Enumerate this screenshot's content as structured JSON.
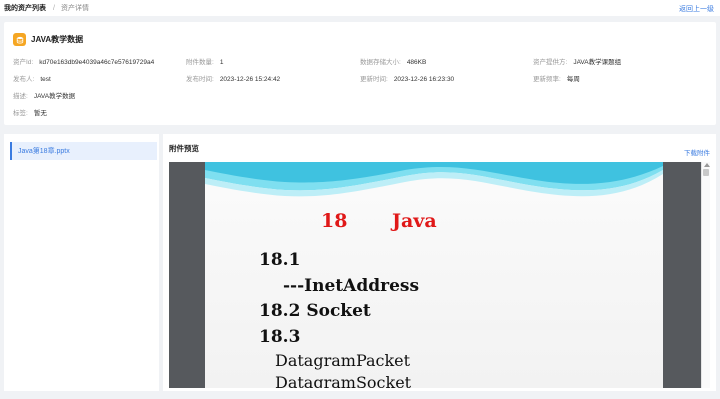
{
  "breadcrumb": {
    "root": "我的资产列表",
    "separator": "/",
    "current": "资产详情"
  },
  "back_label": "返回上一级",
  "asset": {
    "title": "JAVA教学数据",
    "fields": {
      "id": {
        "label": "资产Id:",
        "value": "kd70e163db9e4039a46c7e57619729a4"
      },
      "attachments": {
        "label": "附件数量:",
        "value": "1"
      },
      "size": {
        "label": "数据存储大小:",
        "value": "486KB"
      },
      "provider": {
        "label": "资产提供方:",
        "value": "JAVA教学课题组"
      },
      "publisher": {
        "label": "发布人:",
        "value": "test"
      },
      "publish_time": {
        "label": "发布时间:",
        "value": "2023-12-26 15:24:42"
      },
      "update_time": {
        "label": "更新时间:",
        "value": "2023-12-26 16:23:30"
      },
      "frequency": {
        "label": "更新频率:",
        "value": "每周"
      },
      "description": {
        "label": "描述:",
        "value": "JAVA教学数据"
      },
      "tags": {
        "label": "标签:",
        "value": "暂无"
      }
    }
  },
  "files": [
    {
      "name": "Java第18章.pptx"
    }
  ],
  "preview": {
    "title": "附件预览",
    "download_label": "下载附件",
    "slide": {
      "chapter_number": "18",
      "chapter_title": "Java",
      "lines": [
        "18.1",
        "---InetAddress",
        "18.2  Socket",
        "18.3",
        "DatagramPacket",
        "DatagramSocket"
      ]
    }
  },
  "colors": {
    "accent": "#3a7be0",
    "icon_bg": "#f5a623",
    "slide_red": "#e01818",
    "wave": "#5ad0e8"
  }
}
